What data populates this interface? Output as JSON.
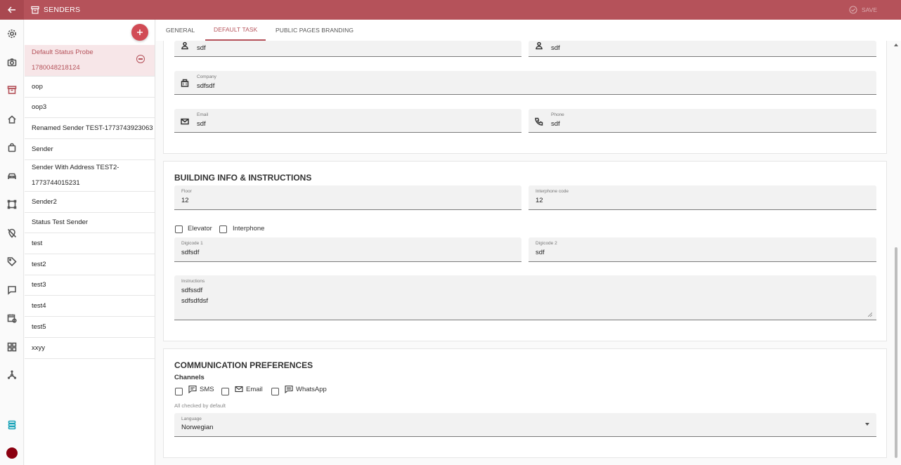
{
  "window": {
    "title": "SENDERS",
    "save_label": "SAVE"
  },
  "senders": {
    "items": [
      {
        "label": "Default Status Probe",
        "label2": "1780048218124"
      },
      {
        "label": "oop"
      },
      {
        "label": "oop3"
      },
      {
        "label": "Renamed Sender TEST-1773743923063"
      },
      {
        "label": "Sender"
      },
      {
        "label": "Sender With Address TEST2-",
        "label2": "1773744015231"
      },
      {
        "label": "Sender2"
      },
      {
        "label": "Status Test Sender"
      },
      {
        "label": "test"
      },
      {
        "label": "test2"
      },
      {
        "label": "test3"
      },
      {
        "label": "test4"
      },
      {
        "label": "test5"
      },
      {
        "label": "xxyy"
      }
    ]
  },
  "tabs": [
    "GENERAL",
    "DEFAULT TASK",
    "PUBLIC PAGES BRANDING"
  ],
  "contact": {
    "first_name": {
      "value": "sdf"
    },
    "last_name": {
      "value": "sdf"
    },
    "company": {
      "label": "Company",
      "value": "sdfsdf"
    },
    "email": {
      "label": "Email",
      "value": "sdf"
    },
    "phone": {
      "label": "Phone",
      "value": "sdf"
    }
  },
  "building": {
    "title": "BUILDING INFO & INSTRUCTIONS",
    "floor": {
      "label": "Floor",
      "value": "12"
    },
    "interphone_code": {
      "label": "Interphone code",
      "value": "12"
    },
    "elevator_label": "Elevator",
    "interphone_label": "Interphone",
    "digicode1": {
      "label": "Digicode 1",
      "value": "sdfsdf"
    },
    "digicode2": {
      "label": "Digicode 2",
      "value": "sdf"
    },
    "instructions": {
      "label": "Instructions",
      "line1": "sdfssdf",
      "line2": "sdfsdfdsf"
    }
  },
  "communication": {
    "title": "COMMUNICATION PREFERENCES",
    "channels_label": "Channels",
    "sms_label": "SMS",
    "email_label": "Email",
    "whatsapp_label": "WhatsApp",
    "hint": "All checked by default",
    "language": {
      "label": "Language",
      "value": "Norwegian"
    }
  },
  "colors": {
    "brand": "#b5525a",
    "accent_button": "#d14b55",
    "selected_bg": "#f7e6e8"
  }
}
